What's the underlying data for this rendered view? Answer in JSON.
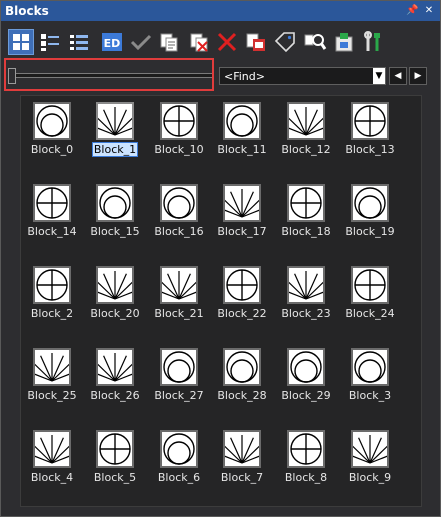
{
  "panel": {
    "title": "Blocks"
  },
  "toolbar": {
    "tools": [
      {
        "name": "large-icons-view-icon",
        "active": true
      },
      {
        "name": "small-icons-view-icon",
        "active": false
      },
      {
        "name": "list-view-icon",
        "active": false
      },
      {
        "name": "block-editor-icon",
        "active": false
      },
      {
        "name": "checkmark-icon",
        "active": false
      },
      {
        "name": "copy-block-icon",
        "active": false
      },
      {
        "name": "delete-block-icon",
        "active": false
      },
      {
        "name": "red-x-icon",
        "active": false
      },
      {
        "name": "paste-block-icon",
        "active": false
      },
      {
        "name": "tag-icon",
        "active": false
      },
      {
        "name": "find-icon",
        "active": false
      },
      {
        "name": "insert-icon",
        "active": false
      },
      {
        "name": "tools-icon",
        "active": false
      }
    ]
  },
  "find": {
    "placeholder": "<Find>"
  },
  "blocks": [
    {
      "label": "Block_0",
      "sym": "circle"
    },
    {
      "label": "Block_1",
      "sym": "fan",
      "selected": true
    },
    {
      "label": "Block_10",
      "sym": "cross"
    },
    {
      "label": "Block_11",
      "sym": "circle"
    },
    {
      "label": "Block_12",
      "sym": "fan"
    },
    {
      "label": "Block_13",
      "sym": "cross"
    },
    {
      "label": "Block_14",
      "sym": "cross"
    },
    {
      "label": "Block_15",
      "sym": "circle"
    },
    {
      "label": "Block_16",
      "sym": "circle"
    },
    {
      "label": "Block_17",
      "sym": "fan"
    },
    {
      "label": "Block_18",
      "sym": "cross"
    },
    {
      "label": "Block_19",
      "sym": "circle"
    },
    {
      "label": "Block_2",
      "sym": "cross"
    },
    {
      "label": "Block_20",
      "sym": "fan"
    },
    {
      "label": "Block_21",
      "sym": "fan"
    },
    {
      "label": "Block_22",
      "sym": "cross"
    },
    {
      "label": "Block_23",
      "sym": "fan"
    },
    {
      "label": "Block_24",
      "sym": "cross"
    },
    {
      "label": "Block_25",
      "sym": "fan"
    },
    {
      "label": "Block_26",
      "sym": "fan"
    },
    {
      "label": "Block_27",
      "sym": "circle"
    },
    {
      "label": "Block_28",
      "sym": "circle"
    },
    {
      "label": "Block_29",
      "sym": "circle"
    },
    {
      "label": "Block_3",
      "sym": "circle"
    },
    {
      "label": "Block_4",
      "sym": "fan"
    },
    {
      "label": "Block_5",
      "sym": "cross"
    },
    {
      "label": "Block_6",
      "sym": "circle"
    },
    {
      "label": "Block_7",
      "sym": "fan"
    },
    {
      "label": "Block_8",
      "sym": "cross"
    },
    {
      "label": "Block_9",
      "sym": "fan"
    }
  ]
}
